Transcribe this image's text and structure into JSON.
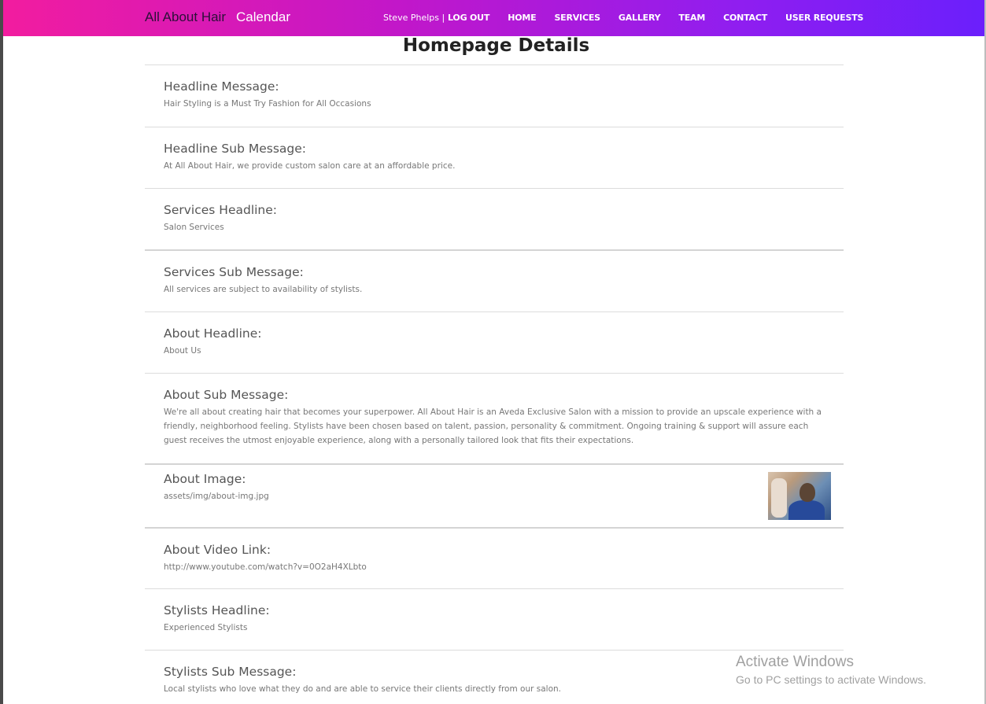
{
  "navbar": {
    "brand": "All About Hair",
    "calendar": "Calendar",
    "user": "Steve Phelps |",
    "items": [
      "LOG OUT",
      "HOME",
      "SERVICES",
      "GALLERY",
      "TEAM",
      "CONTACT",
      "USER REQUESTS"
    ]
  },
  "page_title": "Homepage Details",
  "fields": [
    {
      "label": "Headline Message:",
      "value": "Hair Styling is a Must Try Fashion for All Occasions"
    },
    {
      "label": "Headline Sub Message:",
      "value": "At All About Hair, we provide custom salon care at an affordable price."
    },
    {
      "label": "Services Headline:",
      "value": "Salon Services"
    },
    {
      "label": "Services Sub Message:",
      "value": "All services are subject to availability of stylists."
    },
    {
      "label": "About Headline:",
      "value": "About Us"
    },
    {
      "label": "About Sub Message:",
      "value": "We're all about creating hair that becomes your superpower. All About Hair is an Aveda Exclusive Salon with a mission to provide an upscale experience with a friendly, neighborhood feeling. Stylists have been chosen based on talent, passion, personality & commitment. Ongoing training & support will assure each guest receives the utmost enjoyable experience, along with a personally tailored look that fits their expectations."
    },
    {
      "label": "About Image:",
      "value": "assets/img/about-img.jpg"
    },
    {
      "label": "About Video Link:",
      "value": "http://www.youtube.com/watch?v=0O2aH4XLbto"
    },
    {
      "label": "Stylists Headline:",
      "value": "Experienced Stylists"
    },
    {
      "label": "Stylists Sub Message:",
      "value": "Local stylists who love what they do and are able to service their clients directly from our salon."
    }
  ],
  "watermark": {
    "title": "Activate Windows",
    "subtitle": "Go to PC settings to activate Windows."
  }
}
